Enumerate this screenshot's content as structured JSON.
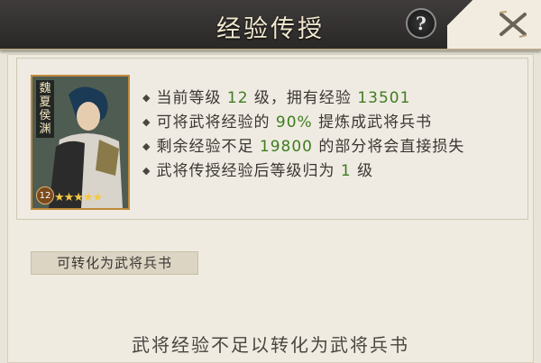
{
  "header": {
    "title": "经验传授",
    "help_label": "?"
  },
  "card": {
    "name_vertical": "魏 夏 侯 渊",
    "level": "12",
    "stars": "★★★★★"
  },
  "info_lines": [
    {
      "a": "当前等级 ",
      "v1": "12",
      "b": " 级，拥有经验 ",
      "v2": "13501",
      "c": ""
    },
    {
      "a": "可将武将经验的 ",
      "v1": "90%",
      "b": " 提炼成武将兵书",
      "v2": "",
      "c": ""
    },
    {
      "a": "剩余经验不足 ",
      "v1": "19800",
      "b": " 的部分将会直接损失",
      "v2": "",
      "c": ""
    },
    {
      "a": "武将传授经验后等级归为 ",
      "v1": "1",
      "b": " 级",
      "v2": "",
      "c": ""
    }
  ],
  "convert_label": "可转化为武将兵书",
  "message": "武将经验不足以转化为武将兵书",
  "colors": {
    "value_green": "#3f7d1f",
    "header_bg": "#2f2d2c"
  }
}
